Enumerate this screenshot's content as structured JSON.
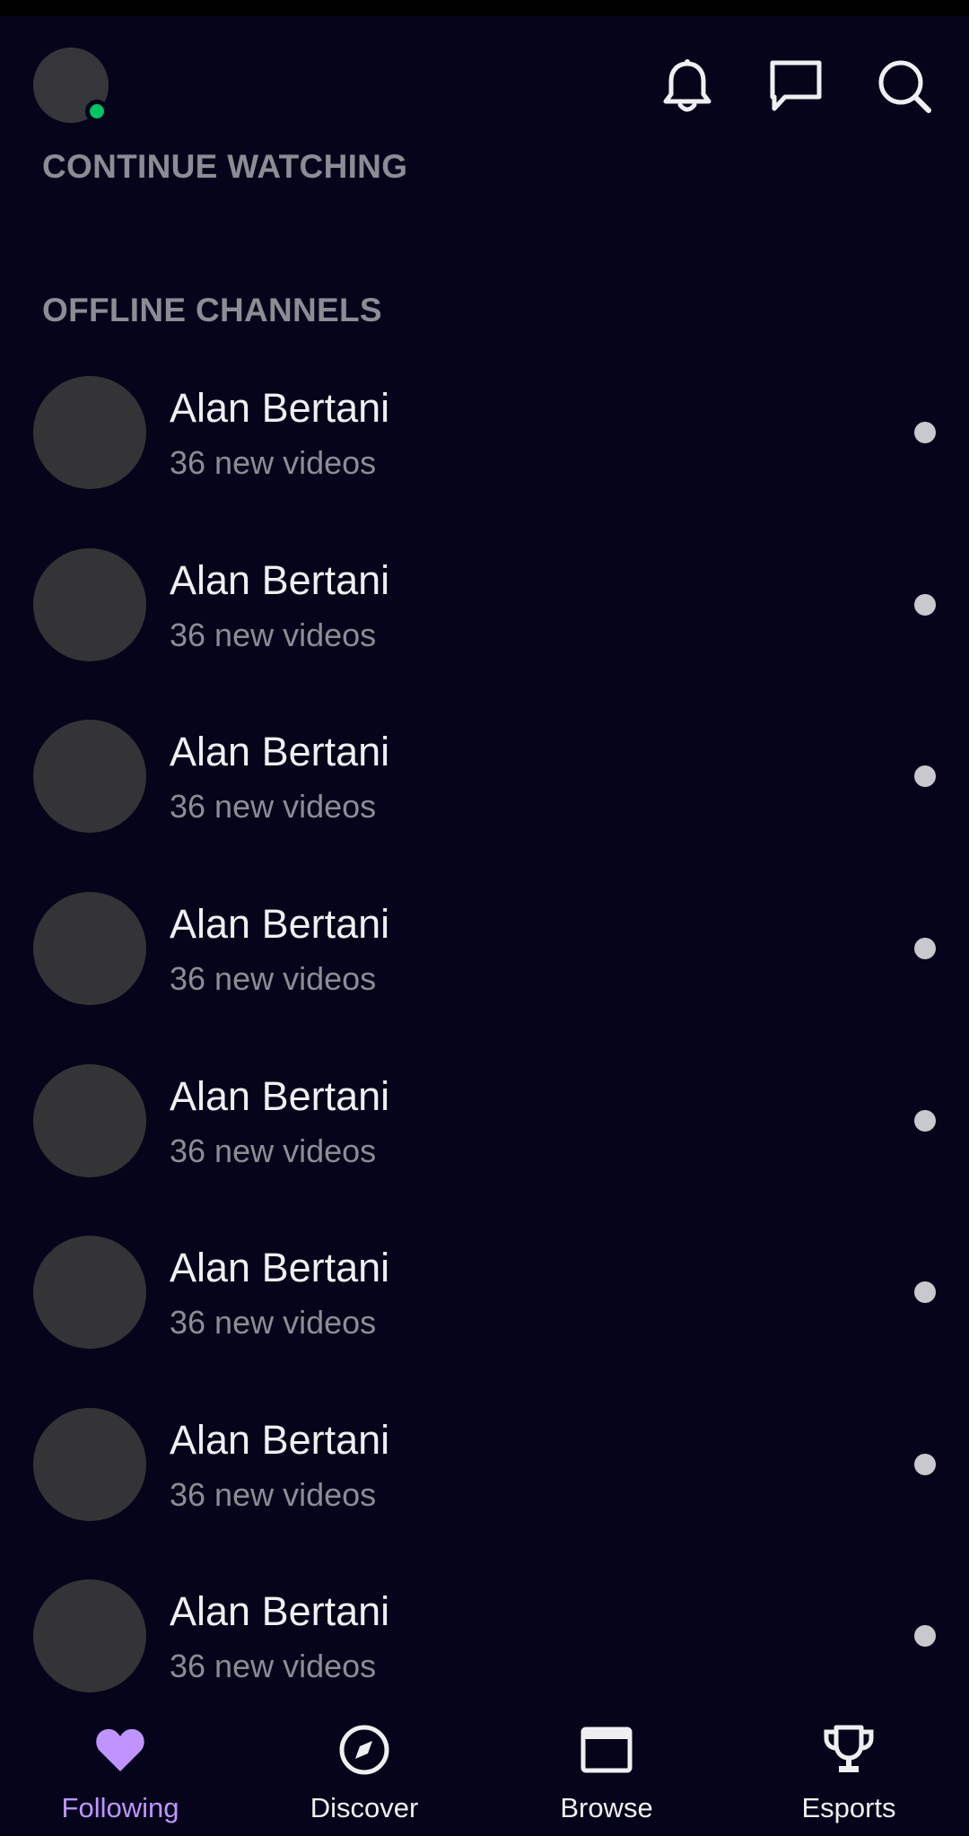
{
  "header": {
    "icons": [
      "bell-icon",
      "chat-bubble-icon",
      "search-icon"
    ],
    "online_color": "#00c463"
  },
  "sections": {
    "continue_watching": "CONTINUE WATCHING",
    "offline_channels": "OFFLINE CHANNELS"
  },
  "channels": [
    {
      "name": "Alan Bertani",
      "subtitle": "36 new videos"
    },
    {
      "name": "Alan Bertani",
      "subtitle": "36 new videos"
    },
    {
      "name": "Alan Bertani",
      "subtitle": "36 new videos"
    },
    {
      "name": "Alan Bertani",
      "subtitle": "36 new videos"
    },
    {
      "name": "Alan Bertani",
      "subtitle": "36 new videos"
    },
    {
      "name": "Alan Bertani",
      "subtitle": "36 new videos"
    },
    {
      "name": "Alan Bertani",
      "subtitle": "36 new videos"
    },
    {
      "name": "Alan Bertani",
      "subtitle": "36 new videos"
    }
  ],
  "bottom_nav": {
    "following": "Following",
    "discover": "Discover",
    "browse": "Browse",
    "esports": "Esports"
  },
  "colors": {
    "background": "#05041a",
    "accent": "#bf94ff",
    "muted_text": "#8c8c95"
  }
}
